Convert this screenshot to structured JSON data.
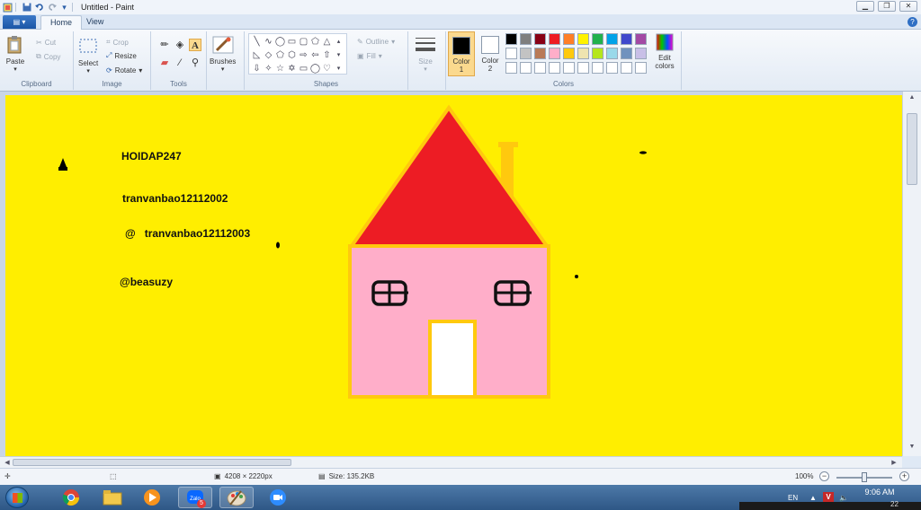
{
  "window": {
    "title": "Untitled - Paint",
    "controls": [
      "minimize",
      "restore",
      "close"
    ]
  },
  "tabs": {
    "file_label": "",
    "items": [
      {
        "label": "Home",
        "active": true
      },
      {
        "label": "View",
        "active": false
      }
    ]
  },
  "ribbon": {
    "clipboard": {
      "group_label": "Clipboard",
      "paste": "Paste",
      "cut": "Cut",
      "copy": "Copy"
    },
    "image": {
      "group_label": "Image",
      "select": "Select",
      "crop": "Crop",
      "resize": "Resize",
      "rotate": "Rotate"
    },
    "tools": {
      "group_label": "Tools"
    },
    "brushes": {
      "label": "Brushes"
    },
    "shapes": {
      "group_label": "Shapes",
      "outline": "Outline",
      "fill": "Fill"
    },
    "size": {
      "label": "Size"
    },
    "colors": {
      "group_label": "Colors",
      "color1_label": "Color 1",
      "color2_label": "Color 2",
      "color1_value": "#000000",
      "color2_value": "#ffffff",
      "edit_colors": "Edit colors",
      "palette": [
        "#000000",
        "#7f7f7f",
        "#880015",
        "#ed1c24",
        "#ff7f27",
        "#fff200",
        "#22b14c",
        "#00a2e8",
        "#3f48cc",
        "#a349a4",
        "#ffffff",
        "#c3c3c3",
        "#b97a57",
        "#ffaec9",
        "#ffc90e",
        "#efe4b0",
        "#b5e61d",
        "#99d9ea",
        "#7092be",
        "#c8bfe7",
        "#ffffff",
        "#ffffff",
        "#ffffff",
        "#ffffff",
        "#ffffff",
        "#ffffff",
        "#ffffff",
        "#ffffff",
        "#ffffff",
        "#ffffff"
      ]
    }
  },
  "canvas": {
    "background": "#ffee00",
    "texts": {
      "t1": "HOIDAP247",
      "t2": "tranvanbao12112002",
      "t3": "@   tranvanbao12112003",
      "t4": "@beasuzy"
    },
    "house_colors": {
      "roof": "#ed1c24",
      "wall": "#ffaec9",
      "outline": "#ffc90e",
      "door": "#ffffff",
      "window_frame": "#111111"
    }
  },
  "status": {
    "dimensions": "4208 × 2220px",
    "size": "Size: 135.2KB",
    "zoom": "100%"
  },
  "taskbar": {
    "apps": [
      "windows-start",
      "chrome",
      "file-explorer",
      "media-player",
      "zalo",
      "paint",
      "zoom"
    ],
    "zalo_badge": "5",
    "language": "EN",
    "time": "9:06 AM",
    "date_partial": "22"
  }
}
